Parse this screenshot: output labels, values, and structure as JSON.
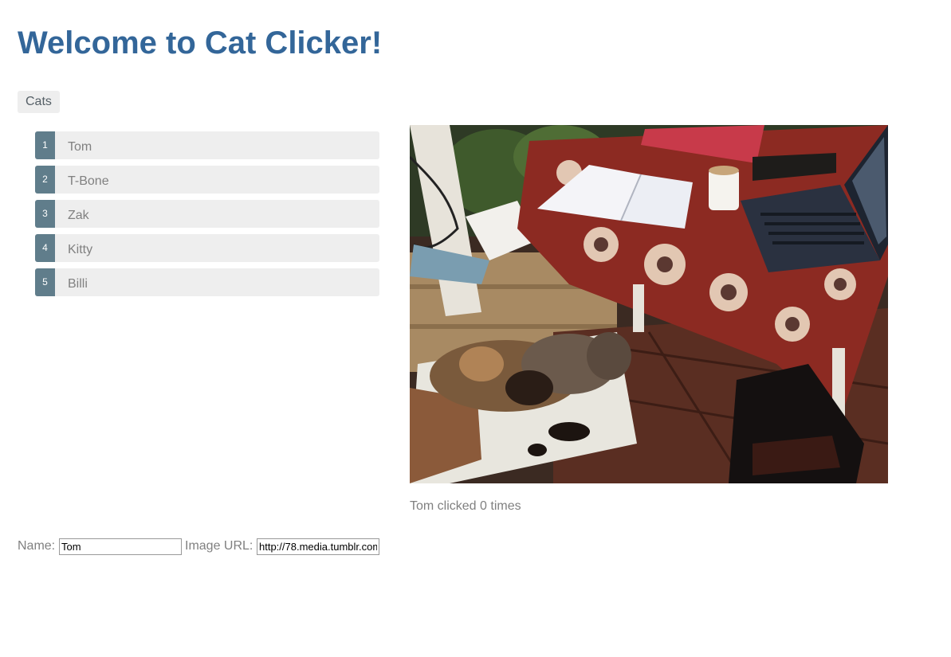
{
  "header": {
    "title": "Welcome to Cat Clicker!"
  },
  "cat_list": {
    "label": "Cats",
    "items": [
      {
        "number": "1",
        "name": "Tom"
      },
      {
        "number": "2",
        "name": "T-Bone"
      },
      {
        "number": "3",
        "name": "Zak"
      },
      {
        "number": "4",
        "name": "Kitty"
      },
      {
        "number": "5",
        "name": "Billi"
      }
    ]
  },
  "cat_view": {
    "photo_description_icon": "cat-photo",
    "click_text": "Tom clicked 0 times"
  },
  "admin": {
    "name_label": "Name:",
    "name_value": "Tom",
    "url_label": "Image URL:",
    "url_value": "http://78.media.tumblr.com"
  },
  "colors": {
    "title": "#336699",
    "badge": "#607d8b",
    "item_bg": "#eeeeee",
    "text_muted": "#808080"
  }
}
